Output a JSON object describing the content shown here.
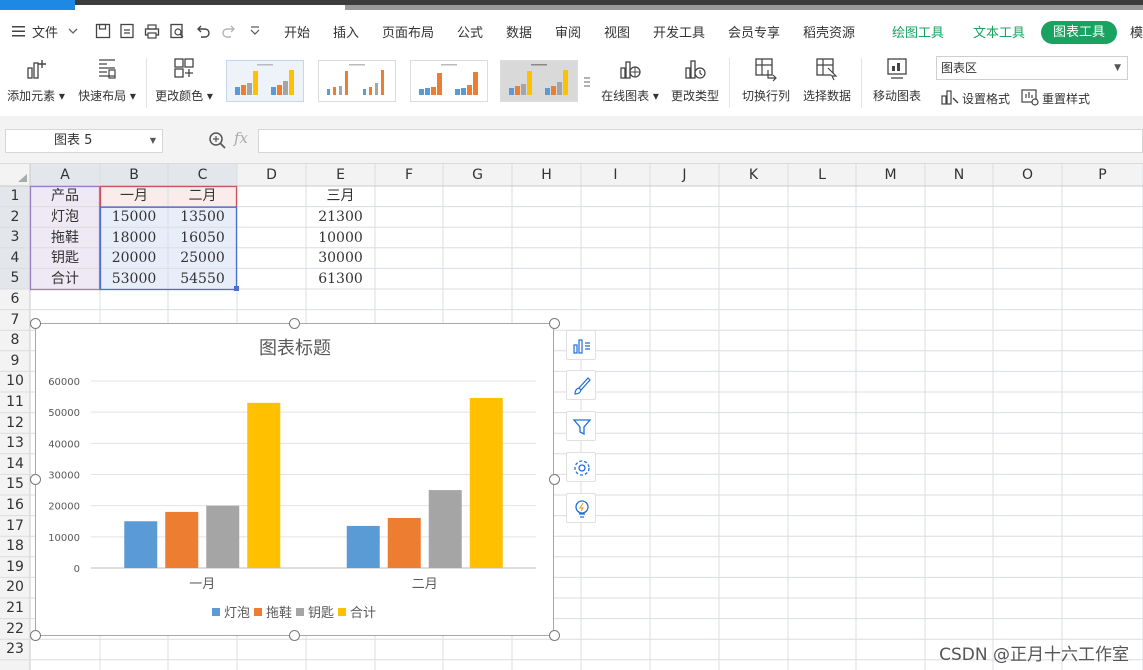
{
  "menubar": {
    "file_label": "文件",
    "tabs": [
      "开始",
      "插入",
      "页面布局",
      "公式",
      "数据",
      "审阅",
      "视图",
      "开发工具",
      "会员专享",
      "稻壳资源"
    ],
    "context_tabs": [
      "绘图工具",
      "文本工具"
    ],
    "active_context_tab": "图表工具",
    "overflow_tab": "模"
  },
  "ribbon": {
    "add_element": "添加元素",
    "quick_layout": "快速布局",
    "change_color": "更改颜色",
    "online_chart": "在线图表",
    "change_type": "更改类型",
    "switch_rowcol": "切换行列",
    "select_data": "选择数据",
    "move_chart": "移动图表",
    "chart_area_select": "图表区",
    "set_format": "设置格式",
    "reset_style": "重置样式"
  },
  "formulabar": {
    "namebox": "图表 5",
    "fx": "fx",
    "value": ""
  },
  "sheet": {
    "columns": [
      "A",
      "B",
      "C",
      "D",
      "E",
      "F",
      "G",
      "H",
      "I",
      "J",
      "K",
      "L",
      "M",
      "N",
      "O",
      "P"
    ],
    "rows": [
      "1",
      "2",
      "3",
      "4",
      "5",
      "6",
      "7",
      "8",
      "9",
      "10",
      "11",
      "12",
      "13",
      "14",
      "15",
      "16",
      "17",
      "18",
      "19",
      "20",
      "21",
      "22",
      "23"
    ],
    "cells": {
      "A1": "产品",
      "B1": "一月",
      "C1": "二月",
      "E1": "三月",
      "A2": "灯泡",
      "B2": "15000",
      "C2": "13500",
      "E2": "21300",
      "A3": "拖鞋",
      "B3": "18000",
      "C3": "16050",
      "E3": "10000",
      "A4": "钥匙",
      "B4": "20000",
      "C4": "25000",
      "E4": "30000",
      "A5": "合计",
      "B5": "53000",
      "C5": "54550",
      "E5": "61300"
    }
  },
  "colors": {
    "accent_green": "#1aa260",
    "series": [
      "#5b9bd5",
      "#ed7d31",
      "#a5a5a5",
      "#ffc000"
    ]
  },
  "chart_data": {
    "type": "bar",
    "title": "图表标题",
    "categories": [
      "一月",
      "二月"
    ],
    "series": [
      {
        "name": "灯泡",
        "values": [
          15000,
          13500
        ]
      },
      {
        "name": "拖鞋",
        "values": [
          18000,
          16050
        ]
      },
      {
        "name": "钥匙",
        "values": [
          20000,
          25000
        ]
      },
      {
        "name": "合计",
        "values": [
          53000,
          54550
        ]
      }
    ],
    "ylim": [
      0,
      60000
    ],
    "yticks": [
      "0",
      "10000",
      "20000",
      "30000",
      "40000",
      "50000",
      "60000"
    ],
    "grid": true,
    "legend": "bottom"
  },
  "chart_side_buttons": [
    "chart-elements-icon",
    "chart-style-brush-icon",
    "chart-filter-icon",
    "chart-settings-gear-icon",
    "chart-smart-bulb-icon"
  ],
  "watermark": "CSDN @正月十六工作室"
}
